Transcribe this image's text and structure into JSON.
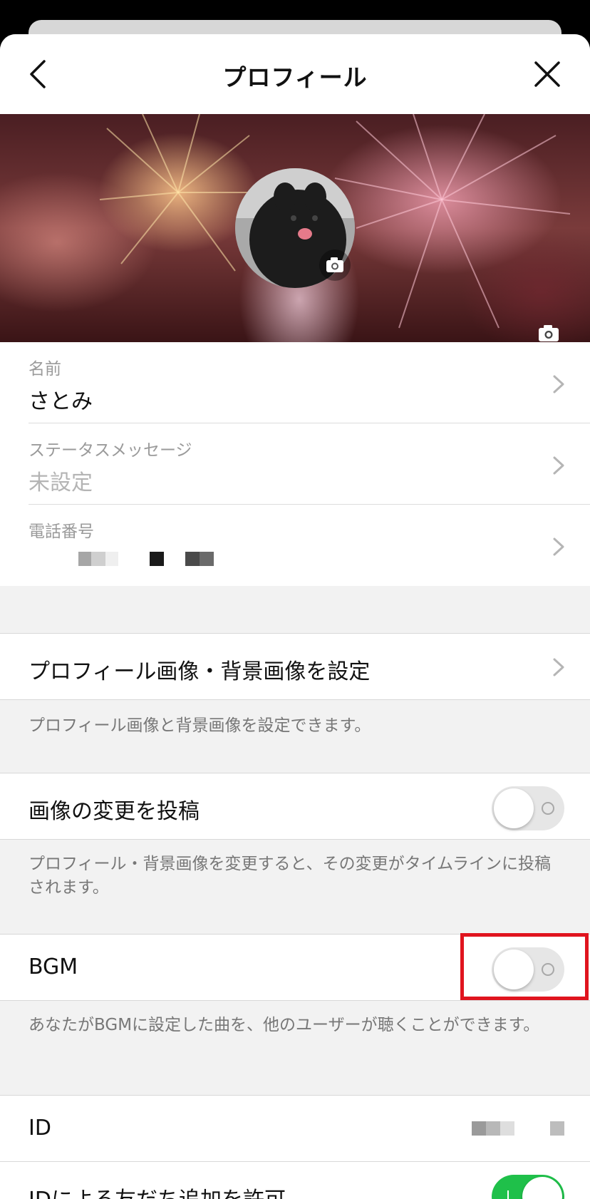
{
  "header": {
    "title": "プロフィール"
  },
  "fields": {
    "name": {
      "label": "名前",
      "value": "さとみ"
    },
    "status": {
      "label": "ステータスメッセージ",
      "value": "未設定"
    },
    "phone": {
      "label": "電話番号"
    }
  },
  "settings": {
    "profile_image": {
      "label": "プロフィール画像・背景画像を設定",
      "desc": "プロフィール画像と背景画像を設定できます。"
    },
    "post_change": {
      "label": "画像の変更を投稿",
      "desc": "プロフィール・背景画像を変更すると、その変更がタイムラインに投稿されます。",
      "enabled": false
    },
    "bgm": {
      "label": "BGM",
      "desc": "あなたがBGMに設定した曲を、他のユーザーが聴くことができます。",
      "enabled": false
    },
    "id": {
      "label": "ID"
    },
    "allow_id_add": {
      "label": "IDによる友だち追加を許可",
      "enabled": true
    }
  },
  "colors": {
    "toggle_on": "#1fc04a",
    "highlight": "#e0141e"
  },
  "icons": [
    "back-arrow-icon",
    "close-icon",
    "camera-icon",
    "chevron-right-icon"
  ]
}
